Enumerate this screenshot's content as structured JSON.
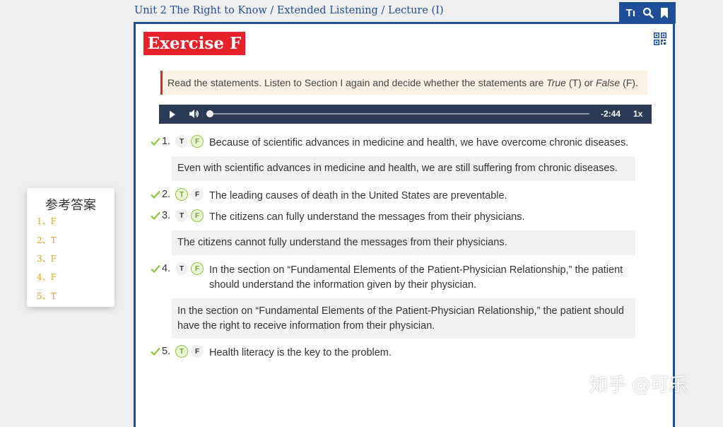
{
  "breadcrumb": "Unit 2 The Right to Know / Extended Listening / Lecture (I)",
  "toolbar": {
    "text_size_label": "Tı",
    "icons": [
      "text-size-icon",
      "search-icon",
      "bookmark-icon"
    ]
  },
  "exercise": {
    "title": "Exercise F",
    "qr_icon": "qr-code-icon",
    "instruction": {
      "before": "Read the statements. Listen to Section I again and decide whether the statements are ",
      "true_word": "True",
      "middle": " (T) or ",
      "false_word": "False",
      "after": " (F)."
    }
  },
  "audio": {
    "time": "-2:44",
    "speed": "1x",
    "progress": 0.0
  },
  "colors": {
    "brand_blue": "#1f4e99",
    "red": "#e62129",
    "green": "#8dc63f",
    "answer_yellow": "#e2a51a"
  },
  "options": {
    "t": "T",
    "f": "F"
  },
  "questions": [
    {
      "num": "1.",
      "selected": "F",
      "text": "Because of scientific advances in medicine and health, we have overcome chronic diseases.",
      "answer": "Even with scientific advances in medicine and health, we are still suffering from chronic diseases."
    },
    {
      "num": "2.",
      "selected": "T",
      "text": "The leading causes of death in the United States are preventable.",
      "answer": ""
    },
    {
      "num": "3.",
      "selected": "F",
      "text": "The citizens can fully understand the messages from their physicians.",
      "answer": "The citizens cannot fully understand the messages from their physicians."
    },
    {
      "num": "4.",
      "selected": "F",
      "text": "In the section on “Fundamental Elements of the Patient-Physician Relationship,” the patient should understand the information given by their physician.",
      "answer": "In the section on “Fundamental Elements of the Patient-Physician Relationship,” the patient should have the right to receive information from their physician."
    },
    {
      "num": "5.",
      "selected": "T",
      "text": "Health literacy is the key to the problem.",
      "answer": ""
    }
  ],
  "answer_key": {
    "title": "参考答案",
    "items": [
      "1、F",
      "2、T",
      "3、F",
      "4、F",
      "5、T"
    ]
  },
  "watermark": "知乎 @可乐"
}
